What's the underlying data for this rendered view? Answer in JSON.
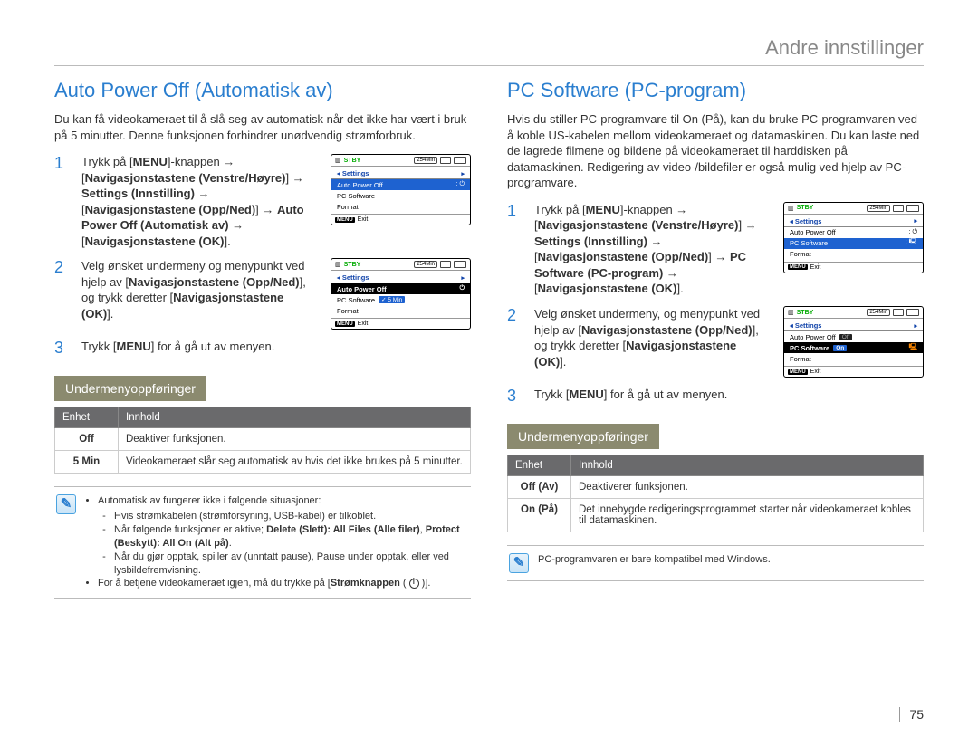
{
  "header": "Andre innstillinger",
  "page_number": "75",
  "left": {
    "title": "Auto Power Off (Automatisk av)",
    "intro": "Du kan få videokameraet til å slå seg av automatisk når det ikke har vært i bruk på 5 minutter. Denne funksjonen forhindrer unødvendig strømforbruk.",
    "steps": [
      {
        "num": "1",
        "text_parts": {
          "a": "Trykk på [",
          "menu": "MENU",
          "b": "]-knappen → [",
          "c": "Navigasjonstastene (Venstre/Høyre)",
          "d": "] → ",
          "e": "Settings (Innstilling)",
          "f": " → [",
          "g": "Navigasjonstastene (Opp/Ned)",
          "h": "] → ",
          "i": "Auto Power Off (Automatisk av)",
          "j": " → [",
          "k": "Navigasjonstastene (OK)",
          "l": "]."
        }
      },
      {
        "num": "2",
        "text_parts": {
          "a": "Velg ønsket undermeny og menypunkt ved hjelp av [",
          "b": "Navigasjonstastene (Opp/Ned)",
          "c": "], og trykk deretter [",
          "d": "Navigasjonstastene (OK)",
          "e": "]."
        }
      },
      {
        "num": "3",
        "text_parts": {
          "a": "Trykk [",
          "menu": "MENU",
          "b": "] for å gå ut av menyen."
        }
      }
    ],
    "submenu_title": "Undermenyoppføringer",
    "table": {
      "headers": [
        "Enhet",
        "Innhold"
      ],
      "rows": [
        {
          "k": "Off",
          "v": "Deaktiver funksjonen."
        },
        {
          "k": "5 Min",
          "v": "Videokameraet slår seg automatisk av hvis det ikke brukes på 5 minutter."
        }
      ]
    },
    "note": {
      "bullet1": "Automatisk av fungerer ikke i følgende situasjoner:",
      "sub1": "Hvis strømkabelen (strømforsyning, USB-kabel) er tilkoblet.",
      "sub2_a": "Når følgende funksjoner er aktive; ",
      "sub2_b": "Delete (Slett): All Files (Alle filer)",
      "sub2_c": ", ",
      "sub2_d": "Protect (Beskytt): All On (Alt på)",
      "sub2_e": ".",
      "sub3": "Når du gjør opptak, spiller av (unntatt pause), Pause under opptak, eller ved lysbildefremvisning.",
      "bullet2_a": "For å betjene videokameraet igjen, må du trykke på [",
      "bullet2_b": "Strømknappen",
      "bullet2_c": " ( ",
      "bullet2_d": " )]."
    },
    "lcd": {
      "stby": "STBY",
      "min": "254Min",
      "settings": "Settings",
      "items": [
        "Auto Power Off",
        "PC Software",
        "Format"
      ],
      "exit": "Exit",
      "menu": "MENU",
      "sub_5min": "5 Min"
    }
  },
  "right": {
    "title": "PC Software (PC-program)",
    "intro": "Hvis du stiller PC-programvare til On (På), kan du bruke PC-programvaren ved å koble US-kabelen mellom videokameraet og datamaskinen. Du kan laste ned de lagrede filmene og bildene på videokameraet til harddisken på datamaskinen. Redigering av video-/bildefiler er også mulig ved hjelp av PC-programvare.",
    "steps": [
      {
        "num": "1",
        "text_parts": {
          "a": "Trykk på [",
          "menu": "MENU",
          "b": "]-knappen → [",
          "c": "Navigasjonstastene (Venstre/Høyre)",
          "d": "] → ",
          "e": "Settings (Innstilling)",
          "f": " → [",
          "g": "Navigasjonstastene (Opp/Ned)",
          "h": "] → ",
          "i": "PC Software (PC-program)",
          "j": " → [",
          "k": "Navigasjonstastene (OK)",
          "l": "]."
        }
      },
      {
        "num": "2",
        "text_parts": {
          "a": "Velg ønsket undermeny, og menypunkt ved hjelp av [",
          "b": "Navigasjonstastene (Opp/Ned)",
          "c": "], og trykk deretter [",
          "d": "Navigasjonstastene (OK)",
          "e": "]."
        }
      },
      {
        "num": "3",
        "text_parts": {
          "a": "Trykk [",
          "menu": "MENU",
          "b": "] for å gå ut av menyen."
        }
      }
    ],
    "submenu_title": "Undermenyoppføringer",
    "table": {
      "headers": [
        "Enhet",
        "Innhold"
      ],
      "rows": [
        {
          "k": "Off (Av)",
          "v": "Deaktiverer funksjonen."
        },
        {
          "k": "On (På)",
          "v": "Det innebygde redigeringsprogrammet starter når videokameraet kobles til datamaskinen."
        }
      ]
    },
    "note": "PC-programvaren er bare kompatibel med Windows.",
    "lcd": {
      "stby": "STBY",
      "min": "254Min",
      "settings": "Settings",
      "items": [
        "Auto Power Off",
        "PC Software",
        "Format"
      ],
      "exit": "Exit",
      "menu": "MENU",
      "sub_off": "Off",
      "sub_on": "On"
    }
  }
}
